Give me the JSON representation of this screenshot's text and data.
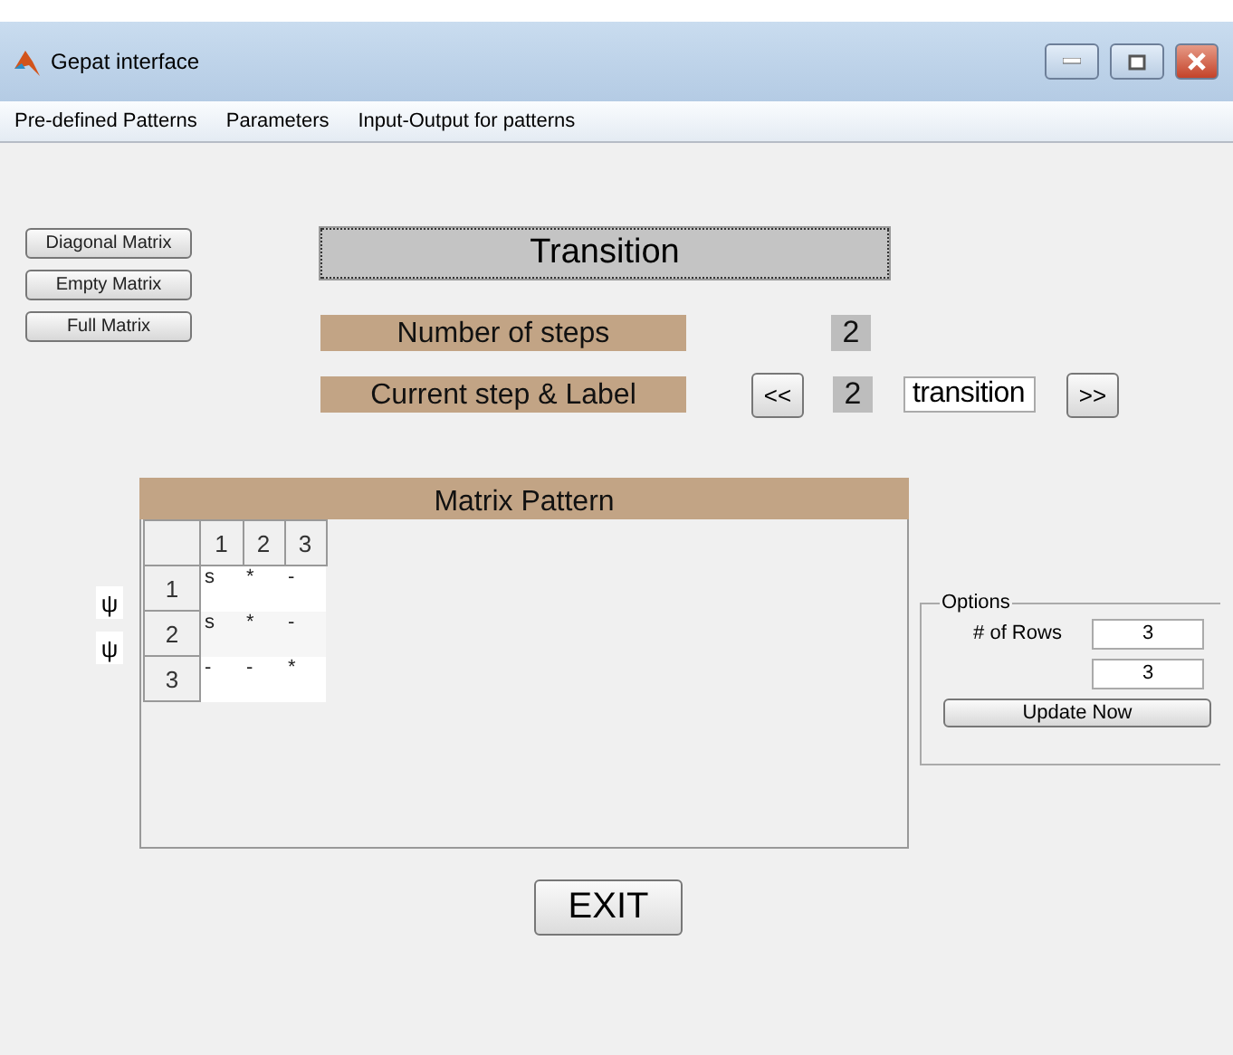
{
  "window": {
    "title": "Gepat interface"
  },
  "menu": [
    "Pre-defined Patterns",
    "Parameters",
    "Input-Output for patterns"
  ],
  "pattern_buttons": [
    "Diagonal Matrix",
    "Empty Matrix",
    "Full Matrix"
  ],
  "transition_button": "Transition",
  "steps": {
    "label": "Number of steps",
    "value": "2"
  },
  "current": {
    "label": "Current step & Label",
    "prev": "<<",
    "value": "2",
    "field": "transition",
    "next": ">>"
  },
  "matrix": {
    "title": "Matrix Pattern",
    "row_marks": [
      "ψ",
      "ψ"
    ],
    "columns": [
      "1",
      "2",
      "3"
    ],
    "rows": [
      {
        "header": "1",
        "cells": [
          "s",
          "*",
          "-"
        ]
      },
      {
        "header": "2",
        "cells": [
          "s",
          "*",
          "-"
        ]
      },
      {
        "header": "3",
        "cells": [
          "-",
          "-",
          "*"
        ]
      }
    ]
  },
  "options": {
    "title": "Options",
    "rows_label": "# of Rows",
    "rows_value": "3",
    "second_value": "3",
    "button": "Update Now"
  },
  "exit_button": "EXIT"
}
